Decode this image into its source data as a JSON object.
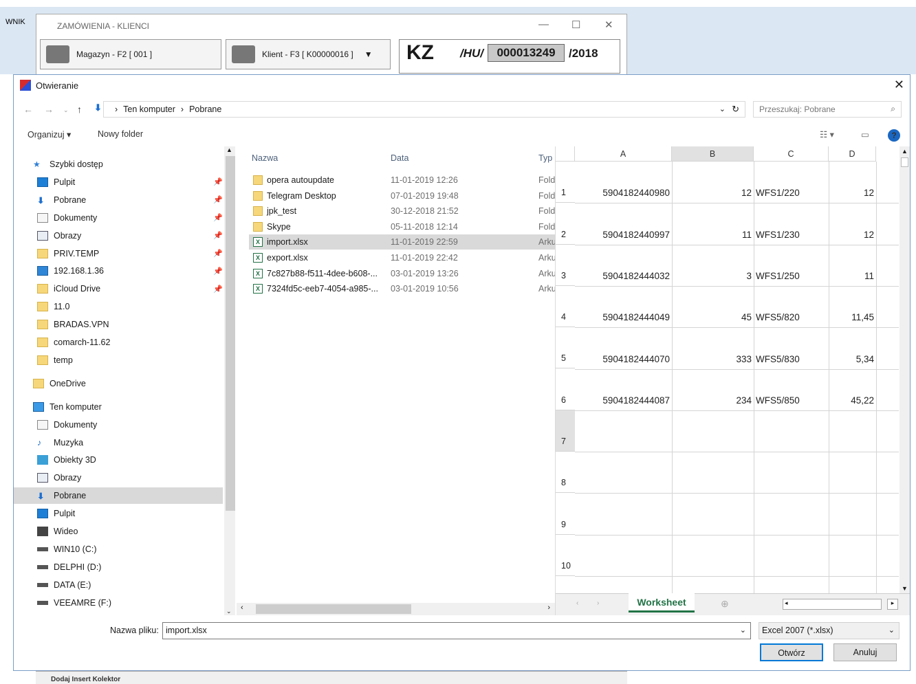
{
  "background": {
    "left_label": "WNIK",
    "window_title": "ZAMÓWIENIA - KLIENCI",
    "magazyn_button": "Magazyn - F2 [ 001 ]",
    "klient_button": "Klient - F3 [ K00000016 ]",
    "doc_type": "KZ",
    "doc_prefix": "/HU/",
    "doc_number": "000013249",
    "doc_year": "/2018",
    "bottom_labels": "Dodaj Insert     Kolektor"
  },
  "dialog": {
    "title": "Otwieranie",
    "breadcrumb": [
      "Ten komputer",
      "Pobrane"
    ],
    "search_placeholder": "Przeszukaj: Pobrane",
    "organize_label": "Organizuj ▾",
    "new_folder_label": "Nowy folder"
  },
  "nav": [
    {
      "label": "Szybki dostęp",
      "icon": "star-icon",
      "pinned": false
    },
    {
      "label": "Pulpit",
      "icon": "desktop-icon",
      "pinned": true
    },
    {
      "label": "Pobrane",
      "icon": "download-icon",
      "pinned": true
    },
    {
      "label": "Dokumenty",
      "icon": "document-icon",
      "pinned": true
    },
    {
      "label": "Obrazy",
      "icon": "pictures-icon",
      "pinned": true
    },
    {
      "label": "PRIV.TEMP",
      "icon": "folder-icon",
      "pinned": true
    },
    {
      "label": "192.168.1.36",
      "icon": "network-icon",
      "pinned": true
    },
    {
      "label": "iCloud Drive",
      "icon": "folder-icon",
      "pinned": true
    },
    {
      "label": "11.0",
      "icon": "folder-icon",
      "pinned": false
    },
    {
      "label": "BRADAS.VPN",
      "icon": "folder-icon",
      "pinned": false
    },
    {
      "label": "comarch-11.62",
      "icon": "folder-icon",
      "pinned": false
    },
    {
      "label": "temp",
      "icon": "folder-icon",
      "pinned": false
    },
    {
      "label": "OneDrive",
      "icon": "folder-icon",
      "pinned": false
    },
    {
      "label": "Ten komputer",
      "icon": "computer-icon",
      "pinned": false
    },
    {
      "label": "Dokumenty",
      "icon": "document-icon",
      "pinned": false
    },
    {
      "label": "Muzyka",
      "icon": "music-icon",
      "pinned": false
    },
    {
      "label": "Obiekty 3D",
      "icon": "cube-icon",
      "pinned": false
    },
    {
      "label": "Obrazy",
      "icon": "pictures-icon",
      "pinned": false
    },
    {
      "label": "Pobrane",
      "icon": "download-icon",
      "pinned": false,
      "selected": true
    },
    {
      "label": "Pulpit",
      "icon": "desktop-icon",
      "pinned": false
    },
    {
      "label": "Wideo",
      "icon": "video-icon",
      "pinned": false
    },
    {
      "label": "WIN10 (C:)",
      "icon": "drive-icon",
      "pinned": false
    },
    {
      "label": "DELPHI (D:)",
      "icon": "drive-icon",
      "pinned": false
    },
    {
      "label": "DATA (E:)",
      "icon": "drive-icon",
      "pinned": false
    },
    {
      "label": "VEEAMRE (F:)",
      "icon": "drive-icon",
      "pinned": false
    }
  ],
  "files": {
    "headers": {
      "name": "Nazwa",
      "date": "Data",
      "type": "Typ"
    },
    "rows": [
      {
        "name": "opera autoupdate",
        "date": "11-01-2019 12:26",
        "type": "Folder",
        "icon": "folder-icon"
      },
      {
        "name": "Telegram Desktop",
        "date": "07-01-2019 19:48",
        "type": "Folder",
        "icon": "folder-icon"
      },
      {
        "name": "jpk_test",
        "date": "30-12-2018 21:52",
        "type": "Folder",
        "icon": "folder-icon"
      },
      {
        "name": "Skype",
        "date": "05-11-2018 12:14",
        "type": "Folder",
        "icon": "folder-icon"
      },
      {
        "name": "import.xlsx",
        "date": "11-01-2019 22:59",
        "type": "Arkusz",
        "icon": "excel-icon",
        "selected": true
      },
      {
        "name": "export.xlsx",
        "date": "11-01-2019 22:42",
        "type": "Arkusz",
        "icon": "excel-icon"
      },
      {
        "name": "7c827b88-f511-4dee-b608-...",
        "date": "03-01-2019 13:26",
        "type": "Arkusz",
        "icon": "excel-icon"
      },
      {
        "name": "7324fd5c-eeb7-4054-a985-...",
        "date": "03-01-2019 10:56",
        "type": "Arkusz",
        "icon": "excel-icon"
      }
    ]
  },
  "preview": {
    "columns": [
      "A",
      "B",
      "C",
      "D"
    ],
    "row_numbers": [
      "1",
      "2",
      "3",
      "4",
      "5",
      "6",
      "7",
      "8",
      "9",
      "10"
    ],
    "rows": [
      [
        "5904182440980",
        "12",
        "WFS1/220",
        "12"
      ],
      [
        "5904182440997",
        "11",
        "WFS1/230",
        "12"
      ],
      [
        "5904182444032",
        "3",
        "WFS1/250",
        "11"
      ],
      [
        "5904182444049",
        "45",
        "WFS5/820",
        "11,45"
      ],
      [
        "5904182444070",
        "333",
        "WFS5/830",
        "5,34"
      ],
      [
        "5904182444087",
        "234",
        "WFS5/850",
        "45,22"
      ]
    ],
    "sheet_tab": "Worksheet"
  },
  "footer": {
    "filename_label": "Nazwa pliku:",
    "filename_value": "import.xlsx",
    "filetype": "Excel 2007 (*.xlsx)",
    "open_button": "Otwórz",
    "cancel_button": "Anuluj"
  }
}
